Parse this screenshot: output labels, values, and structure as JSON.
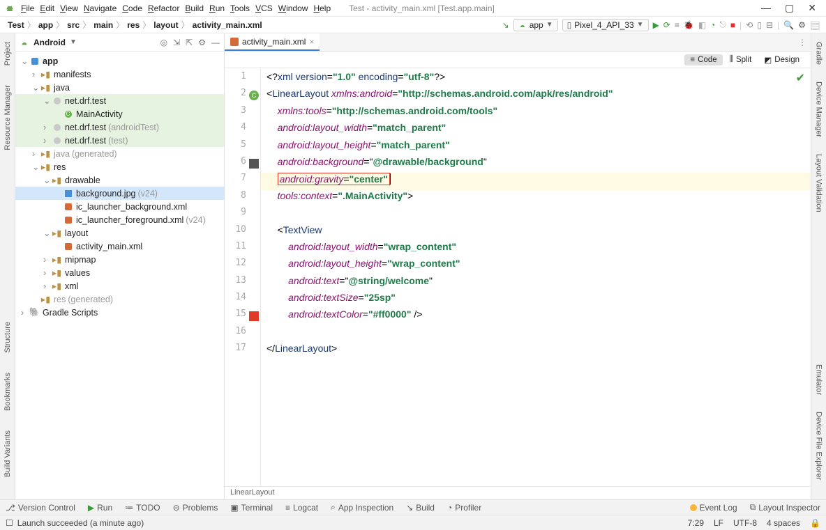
{
  "menubar": {
    "items": [
      "File",
      "Edit",
      "View",
      "Navigate",
      "Code",
      "Refactor",
      "Build",
      "Run",
      "Tools",
      "VCS",
      "Window",
      "Help"
    ],
    "title": "Test - activity_main.xml [Test.app.main]"
  },
  "crumbs": [
    "Test",
    "app",
    "src",
    "main",
    "res",
    "layout",
    "activity_main.xml"
  ],
  "run_config": "app",
  "device": "Pixel_4_API_33",
  "project_view": "Android",
  "tree": [
    {
      "d": 0,
      "o": "v",
      "ic": "app",
      "t": "app",
      "b": true
    },
    {
      "d": 1,
      "o": ">",
      "ic": "folder",
      "t": "manifests"
    },
    {
      "d": 1,
      "o": "v",
      "ic": "folder",
      "t": "java"
    },
    {
      "d": 2,
      "o": "v",
      "ic": "pkg",
      "t": "net.drf.test",
      "hl": true
    },
    {
      "d": 3,
      "o": " ",
      "ic": "cls",
      "t": "MainActivity",
      "hl": true
    },
    {
      "d": 2,
      "o": ">",
      "ic": "pkg",
      "t": "net.drf.test",
      "h": "(androidTest)",
      "hl": true
    },
    {
      "d": 2,
      "o": ">",
      "ic": "pkg",
      "t": "net.drf.test",
      "h": "(test)",
      "hl": true
    },
    {
      "d": 1,
      "o": ">",
      "ic": "folder",
      "t": "java",
      "h": "(generated)",
      "gray": true
    },
    {
      "d": 1,
      "o": "v",
      "ic": "folder",
      "t": "res"
    },
    {
      "d": 2,
      "o": "v",
      "ic": "folder",
      "t": "drawable"
    },
    {
      "d": 3,
      "o": " ",
      "ic": "img",
      "t": "background.jpg",
      "h": "(v24)",
      "sel": true
    },
    {
      "d": 3,
      "o": " ",
      "ic": "xml",
      "t": "ic_launcher_background.xml"
    },
    {
      "d": 3,
      "o": " ",
      "ic": "xml",
      "t": "ic_launcher_foreground.xml",
      "h": "(v24)"
    },
    {
      "d": 2,
      "o": "v",
      "ic": "folder",
      "t": "layout"
    },
    {
      "d": 3,
      "o": " ",
      "ic": "xml",
      "t": "activity_main.xml"
    },
    {
      "d": 2,
      "o": ">",
      "ic": "folder",
      "t": "mipmap"
    },
    {
      "d": 2,
      "o": ">",
      "ic": "folder",
      "t": "values"
    },
    {
      "d": 2,
      "o": ">",
      "ic": "folder",
      "t": "xml"
    },
    {
      "d": 1,
      "o": " ",
      "ic": "folder",
      "t": "res",
      "h": "(generated)",
      "gray": true
    },
    {
      "d": 0,
      "o": ">",
      "ic": "gradle",
      "t": "Gradle Scripts"
    }
  ],
  "tab": "activity_main.xml",
  "view_modes": {
    "code": "Code",
    "split": "Split",
    "design": "Design"
  },
  "code_lines": [
    {
      "n": 1,
      "segs": [
        {
          "c": "tok-dk",
          "t": "<?"
        },
        {
          "c": "tok-tag",
          "t": "xml version"
        },
        {
          "c": "tok-dk",
          "t": "="
        },
        {
          "c": "tok-val",
          "t": "\"1.0\""
        },
        {
          "c": "tok-dk",
          "t": " "
        },
        {
          "c": "tok-tag",
          "t": "encoding"
        },
        {
          "c": "tok-dk",
          "t": "="
        },
        {
          "c": "tok-val",
          "t": "\"utf-8\""
        },
        {
          "c": "tok-dk",
          "t": "?>"
        }
      ]
    },
    {
      "n": 2,
      "gic": "C",
      "segs": [
        {
          "c": "tok-dk",
          "t": "<"
        },
        {
          "c": "tok-tag",
          "t": "LinearLayout "
        },
        {
          "c": "tok-attr",
          "t": "xmlns:android"
        },
        {
          "c": "tok-dk",
          "t": "="
        },
        {
          "c": "tok-val",
          "t": "\"http://schemas.android.com/apk/res/android\""
        }
      ]
    },
    {
      "n": 3,
      "segs": [
        {
          "c": "",
          "t": "    "
        },
        {
          "c": "tok-attr",
          "t": "xmlns:tools"
        },
        {
          "c": "tok-dk",
          "t": "="
        },
        {
          "c": "tok-val",
          "t": "\"http://schemas.android.com/tools\""
        }
      ]
    },
    {
      "n": 4,
      "segs": [
        {
          "c": "",
          "t": "    "
        },
        {
          "c": "tok-attr",
          "t": "android:layout_width"
        },
        {
          "c": "tok-dk",
          "t": "="
        },
        {
          "c": "tok-val",
          "t": "\"match_parent\""
        }
      ]
    },
    {
      "n": 5,
      "segs": [
        {
          "c": "",
          "t": "    "
        },
        {
          "c": "tok-attr",
          "t": "android:layout_height"
        },
        {
          "c": "tok-dk",
          "t": "="
        },
        {
          "c": "tok-val",
          "t": "\"match_parent\""
        }
      ]
    },
    {
      "n": 6,
      "gic": "img",
      "segs": [
        {
          "c": "",
          "t": "    "
        },
        {
          "c": "tok-attr",
          "t": "android:background"
        },
        {
          "c": "tok-dk",
          "t": "=\""
        },
        {
          "c": "tok-val",
          "t": "@drawable/background"
        },
        {
          "c": "tok-dk",
          "t": "\""
        }
      ]
    },
    {
      "n": 7,
      "hl": true,
      "box": true,
      "segs": [
        {
          "c": "",
          "t": "    "
        },
        {
          "c": "tok-attr",
          "t": "android:gravity"
        },
        {
          "c": "tok-dk",
          "t": "="
        },
        {
          "c": "tok-val",
          "t": "\"center\""
        }
      ],
      "caret": true
    },
    {
      "n": 8,
      "segs": [
        {
          "c": "",
          "t": "    "
        },
        {
          "c": "tok-attr",
          "t": "tools:context"
        },
        {
          "c": "tok-dk",
          "t": "="
        },
        {
          "c": "tok-val",
          "t": "\".MainActivity\""
        },
        {
          "c": "tok-dk",
          "t": ">"
        }
      ]
    },
    {
      "n": 9,
      "segs": []
    },
    {
      "n": 10,
      "segs": [
        {
          "c": "",
          "t": "    "
        },
        {
          "c": "tok-dk",
          "t": "<"
        },
        {
          "c": "tok-tag",
          "t": "TextView"
        }
      ]
    },
    {
      "n": 11,
      "segs": [
        {
          "c": "",
          "t": "        "
        },
        {
          "c": "tok-attr",
          "t": "android:layout_width"
        },
        {
          "c": "tok-dk",
          "t": "="
        },
        {
          "c": "tok-val",
          "t": "\"wrap_content\""
        }
      ]
    },
    {
      "n": 12,
      "segs": [
        {
          "c": "",
          "t": "        "
        },
        {
          "c": "tok-attr",
          "t": "android:layout_height"
        },
        {
          "c": "tok-dk",
          "t": "="
        },
        {
          "c": "tok-val",
          "t": "\"wrap_content\""
        }
      ]
    },
    {
      "n": 13,
      "segs": [
        {
          "c": "",
          "t": "        "
        },
        {
          "c": "tok-attr",
          "t": "android:text"
        },
        {
          "c": "tok-dk",
          "t": "=\""
        },
        {
          "c": "tok-val",
          "t": "@string/welcome"
        },
        {
          "c": "tok-dk",
          "t": "\""
        }
      ]
    },
    {
      "n": 14,
      "segs": [
        {
          "c": "",
          "t": "        "
        },
        {
          "c": "tok-attr",
          "t": "android:textSize"
        },
        {
          "c": "tok-dk",
          "t": "="
        },
        {
          "c": "tok-val",
          "t": "\"25sp\""
        }
      ]
    },
    {
      "n": 15,
      "gic": "red",
      "segs": [
        {
          "c": "",
          "t": "        "
        },
        {
          "c": "tok-attr",
          "t": "android:textColor"
        },
        {
          "c": "tok-dk",
          "t": "="
        },
        {
          "c": "tok-val",
          "t": "\"#ff0000\""
        },
        {
          "c": "tok-dk",
          "t": " />"
        }
      ]
    },
    {
      "n": 16,
      "segs": []
    },
    {
      "n": 17,
      "segs": [
        {
          "c": "tok-dk",
          "t": "</"
        },
        {
          "c": "tok-tag",
          "t": "LinearLayout"
        },
        {
          "c": "tok-dk",
          "t": ">"
        }
      ]
    }
  ],
  "editor_breadcrumb": "LinearLayout",
  "left_tools": [
    "Project",
    "Resource Manager",
    "Structure",
    "Bookmarks",
    "Build Variants"
  ],
  "right_tools": [
    "Gradle",
    "Device Manager",
    "Layout Validation",
    "Emulator",
    "Device File Explorer"
  ],
  "bottom_tools": {
    "vc": "Version Control",
    "run": "Run",
    "todo": "TODO",
    "problems": "Problems",
    "terminal": "Terminal",
    "logcat": "Logcat",
    "appinsp": "App Inspection",
    "build": "Build",
    "profiler": "Profiler",
    "eventlog": "Event Log",
    "layoutinsp": "Layout Inspector"
  },
  "status": {
    "msg": "Launch succeeded (a minute ago)",
    "pos": "7:29",
    "sep": "LF",
    "enc": "UTF-8",
    "indent": "4 spaces"
  }
}
